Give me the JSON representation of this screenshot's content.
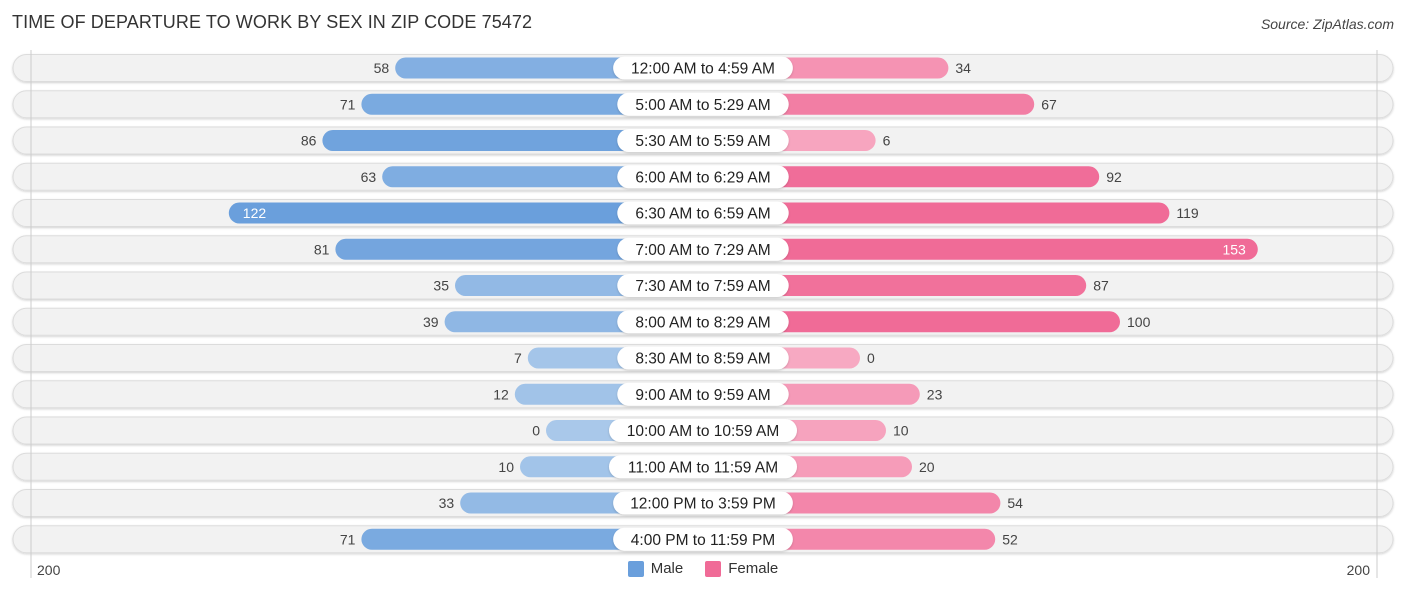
{
  "title": "TIME OF DEPARTURE TO WORK BY SEX IN ZIP CODE 75472",
  "source": "Source: ZipAtlas.com",
  "colors": {
    "male": "#6a9fdc",
    "male_light": "#a9c8ea",
    "female": "#f06b97",
    "female_light": "#f7a9c2",
    "row_bg": "#f2f2f2"
  },
  "chart_data": {
    "type": "bar",
    "orientation": "horizontal-diverging",
    "title": "TIME OF DEPARTURE TO WORK BY SEX IN ZIP CODE 75472",
    "categories": [
      "12:00 AM to 4:59 AM",
      "5:00 AM to 5:29 AM",
      "5:30 AM to 5:59 AM",
      "6:00 AM to 6:29 AM",
      "6:30 AM to 6:59 AM",
      "7:00 AM to 7:29 AM",
      "7:30 AM to 7:59 AM",
      "8:00 AM to 8:29 AM",
      "8:30 AM to 8:59 AM",
      "9:00 AM to 9:59 AM",
      "10:00 AM to 10:59 AM",
      "11:00 AM to 11:59 AM",
      "12:00 PM to 3:59 PM",
      "4:00 PM to 11:59 PM"
    ],
    "series": [
      {
        "name": "Male",
        "values": [
          58,
          71,
          86,
          63,
          122,
          81,
          35,
          39,
          7,
          12,
          0,
          10,
          33,
          71
        ]
      },
      {
        "name": "Female",
        "values": [
          34,
          67,
          6,
          92,
          119,
          153,
          87,
          100,
          0,
          23,
          10,
          20,
          54,
          52
        ]
      }
    ],
    "axis": {
      "left_tick": "200",
      "right_tick": "200",
      "max": 200
    },
    "legend": {
      "position": "bottom-center",
      "entries": [
        "Male",
        "Female"
      ]
    },
    "grid": false
  }
}
